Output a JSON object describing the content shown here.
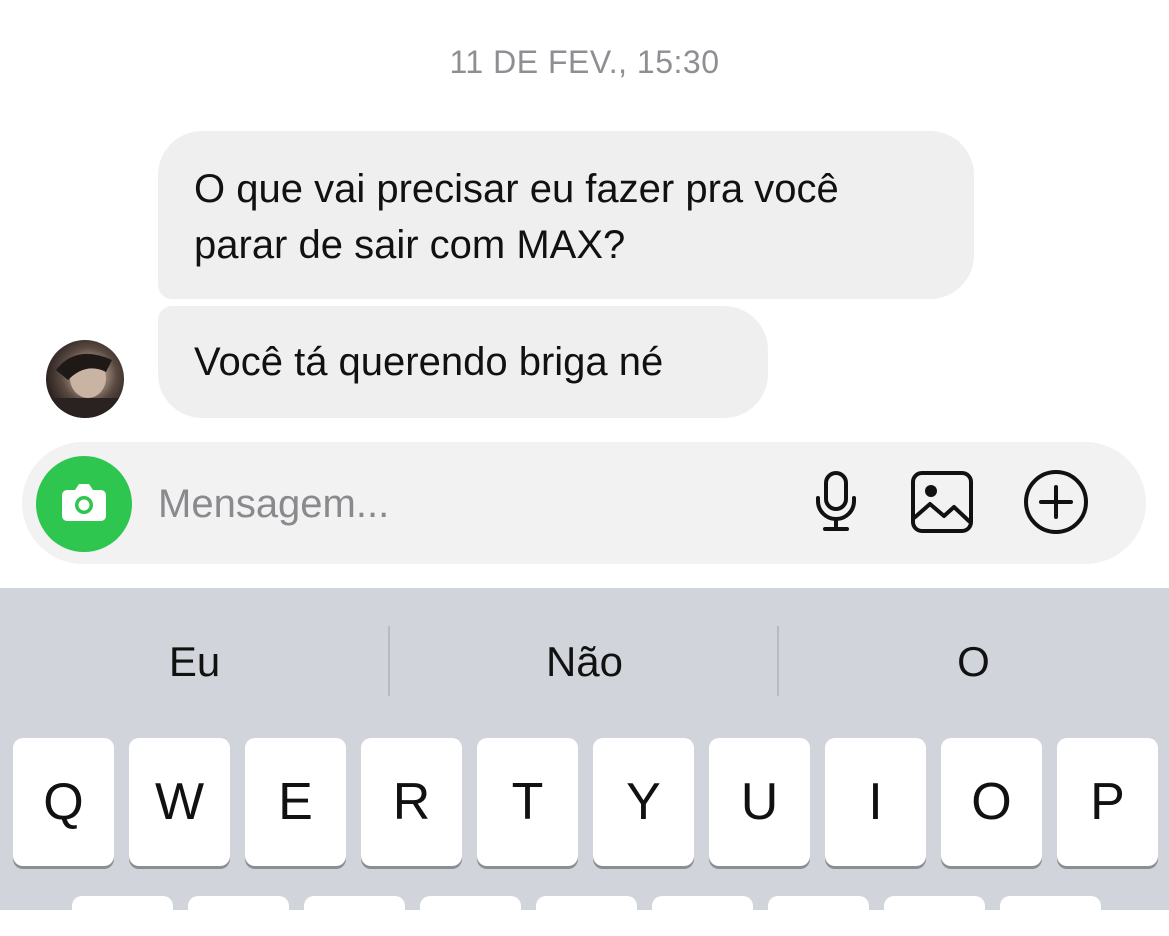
{
  "thread": {
    "timestamp": "11 DE FEV., 15:30",
    "messages": [
      {
        "text": "O que vai precisar eu fazer pra você parar de sair com MAX?"
      },
      {
        "text": "Você tá querendo briga né"
      }
    ]
  },
  "composer": {
    "placeholder": "Mensagem...",
    "accent_color": "#2ec64e",
    "icons": [
      "camera-icon",
      "microphone-icon",
      "gallery-icon",
      "plus-circle-icon"
    ]
  },
  "keyboard": {
    "suggestions": [
      "Eu",
      "Não",
      "O"
    ],
    "row1": [
      "Q",
      "W",
      "E",
      "R",
      "T",
      "Y",
      "U",
      "I",
      "O",
      "P"
    ]
  }
}
